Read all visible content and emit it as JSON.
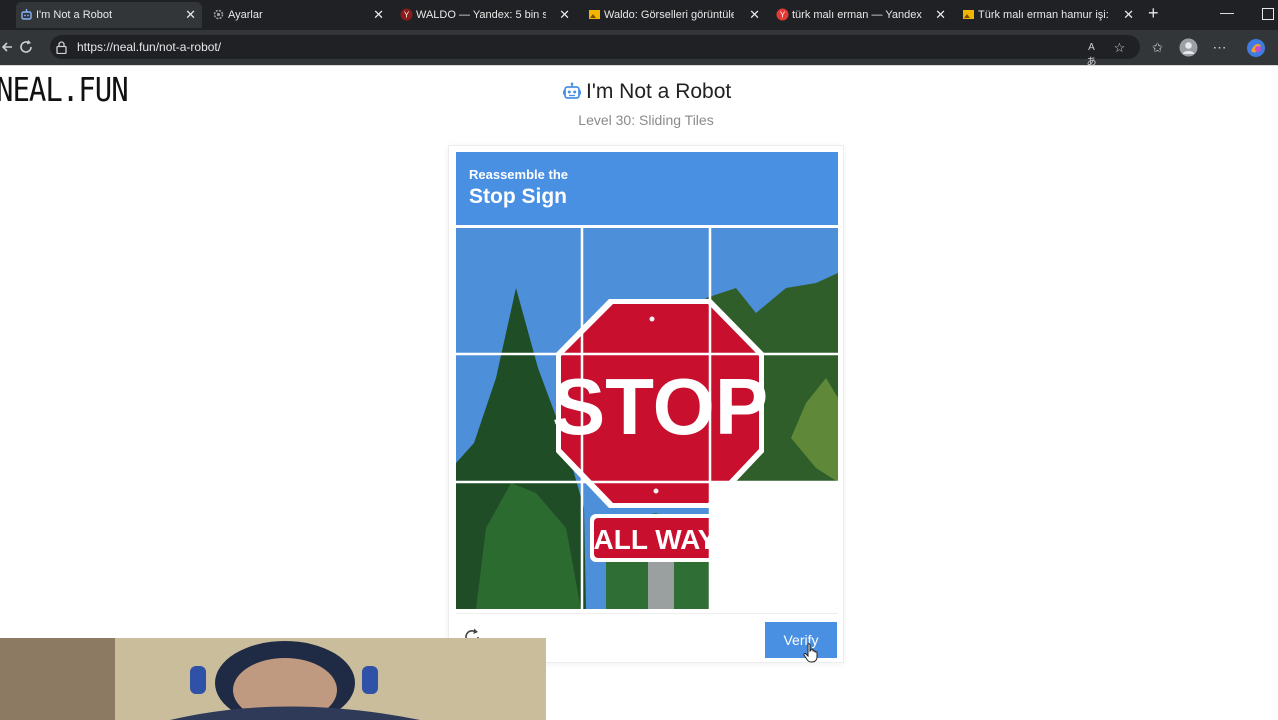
{
  "browser": {
    "tabs": [
      {
        "label": "I'm Not a Robot",
        "active": true
      },
      {
        "label": "Ayarlar",
        "active": false
      },
      {
        "label": "WALDO — Yandex: 5 bin sor",
        "active": false
      },
      {
        "label": "Waldo: Görselleri görüntüley",
        "active": false
      },
      {
        "label": "türk malı erman — Yandex: 1",
        "active": false
      },
      {
        "label": "Türk malı erman hamur işi: G",
        "active": false
      }
    ],
    "url": "https://neal.fun/not-a-robot/",
    "new_tab_symbol": "+",
    "close_symbol": "✕",
    "minimize_symbol": "—"
  },
  "page": {
    "logo": "NEAL.FUN",
    "title": "I'm Not a Robot",
    "subtitle": "Level 30: Sliding Tiles"
  },
  "captcha": {
    "header_small": "Reassemble the",
    "header_big": "Stop Sign",
    "sign_word": "STOP",
    "plate_text": "ALL WAY",
    "verify_label": "Verify",
    "empty_tile": "row 3, column 3"
  },
  "colors": {
    "accent": "#4a90e2",
    "sign_red": "#c8102e",
    "sky": "#4d8fd8",
    "tab_bg": "#202124"
  },
  "icons": {
    "tab_favicon": "robot-icon",
    "reload": "reload-icon",
    "lock": "lock-icon"
  }
}
